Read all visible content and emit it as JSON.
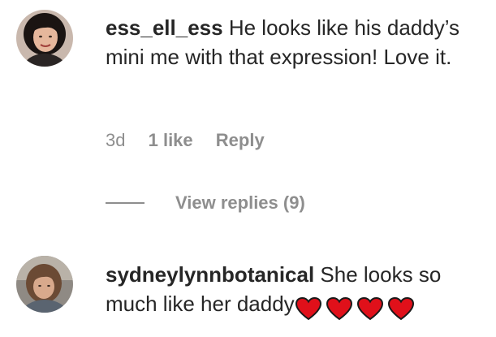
{
  "comments": [
    {
      "username": "ess_ell_ess",
      "text": "He looks like his daddy’s mini me with that expression! Love it.",
      "age": "3d",
      "likes": "1 like",
      "reply_label": "Reply",
      "view_replies": "View replies (9)"
    },
    {
      "username": "sydneylynnbotanical",
      "text": "She looks so much like her daddy",
      "emoji": [
        "red-heart",
        "red-heart",
        "red-heart",
        "red-heart"
      ]
    }
  ],
  "colors": {
    "text": "#262626",
    "secondary": "#8e8e8e",
    "heart": "#e0101a"
  }
}
